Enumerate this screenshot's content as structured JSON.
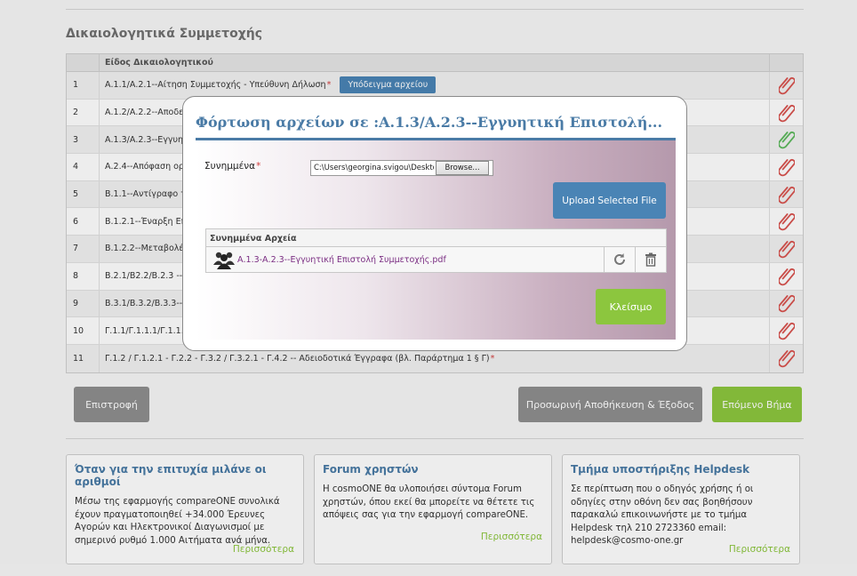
{
  "page": {
    "section_title": "Δικαιολογητικά Συμμετοχής",
    "table": {
      "header_type": "Είδος Δικαιολογητικού",
      "template_button": "Υπόδειγμα αρχείου",
      "required_mark": "*",
      "rows": [
        {
          "num": "1",
          "type": "Α.1.1/Α.2.1--Αίτηση Συμμετοχής - Υπεύθυνη Δήλωση",
          "required": true,
          "has_template": true,
          "attached": false
        },
        {
          "num": "2",
          "type": "Α.1.2/Α.2.2--Αποδε",
          "required": false,
          "has_template": false,
          "attached": false
        },
        {
          "num": "3",
          "type": "Α.1.3/Α.2.3--Εγγυητ",
          "required": false,
          "has_template": false,
          "attached": true
        },
        {
          "num": "4",
          "type": "Α.2.4--Απόφαση ορ",
          "required": false,
          "has_template": false,
          "attached": false
        },
        {
          "num": "5",
          "type": "Β.1.1--Αντίγραφο τ",
          "required": false,
          "has_template": false,
          "attached": false
        },
        {
          "num": "6",
          "type": "Β.1.2.1--Έναρξη Επι",
          "required": false,
          "has_template": false,
          "attached": false
        },
        {
          "num": "7",
          "type": "Β.1.2.2--Μεταβολές",
          "required": false,
          "has_template": false,
          "attached": false
        },
        {
          "num": "8",
          "type": "Β.2.1/Β2.2/Β.2.3 -- Ι",
          "required": false,
          "has_template": false,
          "attached": false
        },
        {
          "num": "9",
          "type": "Β.3.1/Β.3.2/Β.3.3--Μ",
          "required": false,
          "has_template": false,
          "attached": false
        },
        {
          "num": "10",
          "type": "Γ.1.1/Γ.1.1.1/Γ.1.1.2",
          "required": false,
          "has_template": false,
          "attached": false
        },
        {
          "num": "11",
          "type": "Γ.1.2 / Γ.1.2.1 - Γ.2.2 - Γ.3.2 / Γ.3.2.1 - Γ.4.2 -- Αδειοδοτικά Έγγραφα (βλ. Παράρτημα 1 § Γ)",
          "required": true,
          "has_template": false,
          "attached": false
        }
      ]
    },
    "buttons": {
      "back": "Επιστροφή",
      "save_exit": "Προσωρινή Αποθήκευση & Έξοδος",
      "next": "Επόμενο Βήμα"
    },
    "cards": [
      {
        "title": "Όταν για την επιτυχία μιλάνε οι αριθμοί",
        "text": "Μέσω της εφαρμογής compareONE συνολικά έχουν πραγματοποιηθεί +34.000 Έρευνες Αγορών και Ηλεκτρονικοί Διαγωνισμοί με σημερινό ρυθμό 1.000 Αιτήματα ανά μήνα.",
        "more": "Περισσότερα"
      },
      {
        "title": "Forum χρηστών",
        "text": "Η cosmoONE θα υλοποιήσει σύντομα Forum χρηστών, όπου εκεί θα μπορείτε να θέτετε τις απόψεις σας για την εφαρμογή compareONE.",
        "more": "Περισσότερα"
      },
      {
        "title": "Τμήμα υποστήριξης Helpdesk",
        "text": "Σε περίπτωση που ο οδηγός χρήσης ή οι οδηγίες στην οθόνη δεν σας βοηθήσουν παρακαλώ επικοινωνήστε με το τμήμα Helpdesk τηλ 210 2723360 email: helpdesk@cosmo-one.gr",
        "more": "Περισσότερα"
      }
    ]
  },
  "modal": {
    "title": "Φόρτωση αρχείων σε :Α.1.3/Α.2.3--Εγγυητική Επιστολή...",
    "attachments_label": "Συνημμένα",
    "required_mark": "*",
    "file_path": "C:\\Users\\georgina.svigou\\Desktop",
    "browse_label": "Browse...",
    "upload_button": "Upload Selected File",
    "files_header": "Συνημμένα Αρχεία",
    "files": [
      {
        "name": "Α.1.3-Α.2.3--Εγγυητική Επιστολή Συμμετοχής.pdf"
      }
    ],
    "close_button": "Κλείσιμο"
  },
  "colors": {
    "accent_blue": "#4a84b5",
    "title_blue": "#4a7ba6",
    "green": "#8cc63e",
    "grey_button": "#8f8f8f",
    "clip_missing": "#d9534f",
    "clip_attached": "#5cb85c",
    "file_link": "#7a2d82"
  },
  "icons": {
    "row_action": "paperclip-icon",
    "file_owner": "users-icon",
    "replace": "refresh-icon",
    "delete": "trash-icon"
  }
}
